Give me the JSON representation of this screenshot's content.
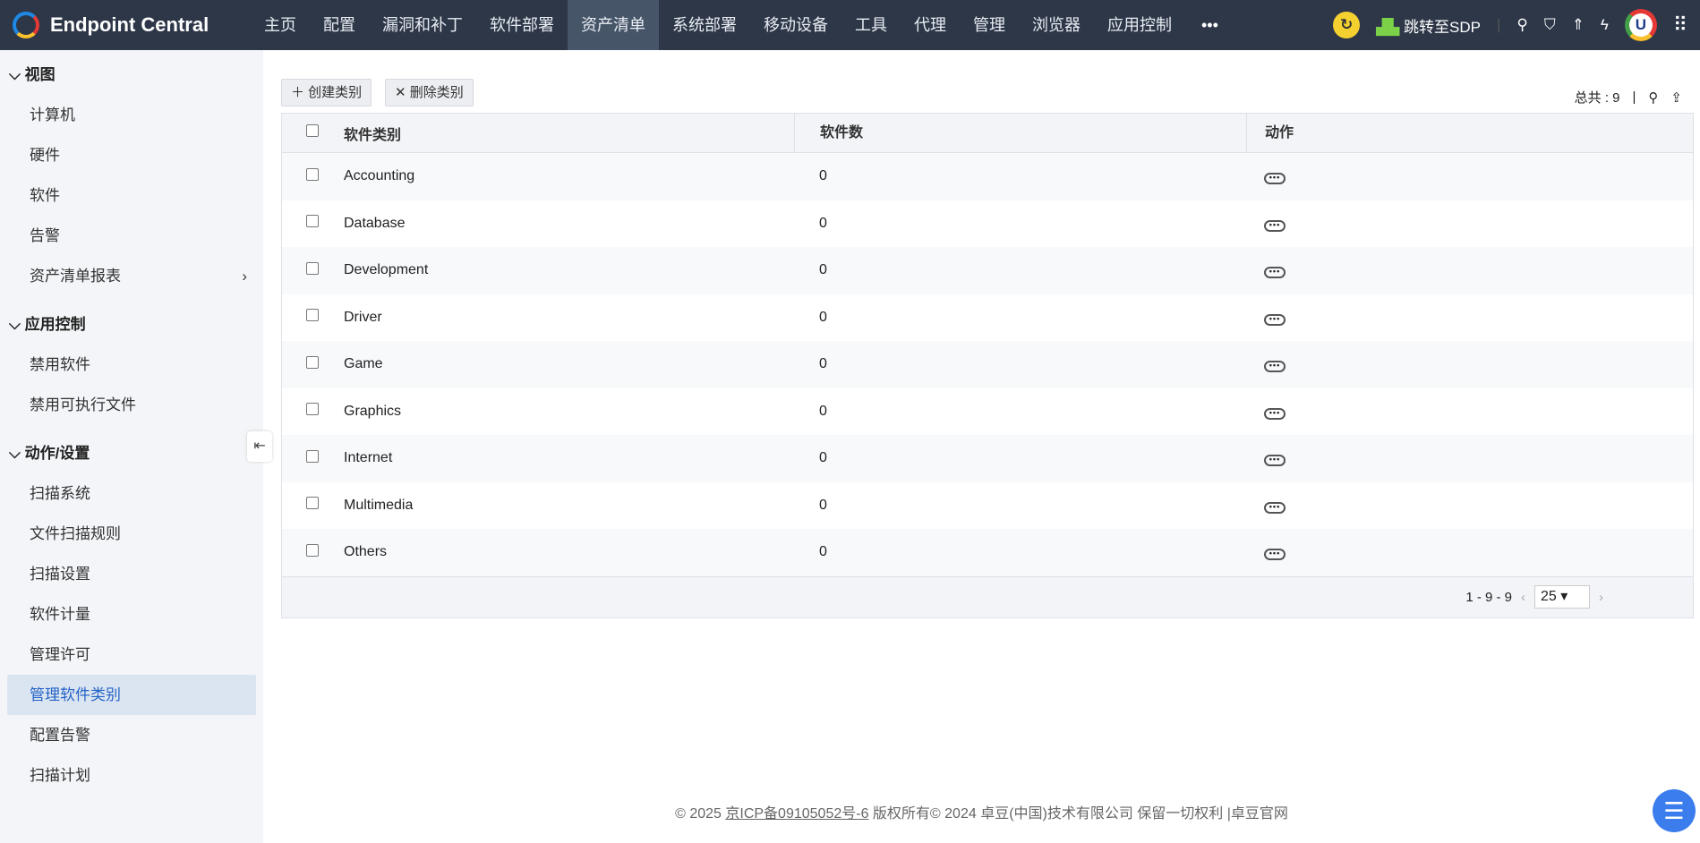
{
  "app": {
    "title": "Endpoint Central"
  },
  "nav": [
    "主页",
    "配置",
    "漏洞和补丁",
    "软件部署",
    "资产清单",
    "系统部署",
    "移动设备",
    "工具",
    "代理",
    "管理",
    "浏览器",
    "应用控制"
  ],
  "nav_more": "•••",
  "topright": {
    "sdp": "跳转至SDP",
    "avatar": "U"
  },
  "sidebar": {
    "sections": [
      {
        "title": "视图",
        "items": [
          "计算机",
          "硬件",
          "软件",
          "告警",
          "资产清单报表"
        ]
      },
      {
        "title": "应用控制",
        "items": [
          "禁用软件",
          "禁用可执行文件"
        ]
      },
      {
        "title": "动作/设置",
        "items": [
          "扫描系统",
          "文件扫描规则",
          "扫描设置",
          "软件计量",
          "管理许可",
          "管理软件类别",
          "配置告警",
          "扫描计划"
        ]
      }
    ],
    "active": "管理软件类别"
  },
  "toolbar": {
    "create": "创建类别",
    "delete": "删除类别",
    "total": "总共 : 9"
  },
  "table": {
    "headers": [
      "软件类别",
      "软件数",
      "动作"
    ],
    "rows": [
      [
        "Accounting",
        "0"
      ],
      [
        "Database",
        "0"
      ],
      [
        "Development",
        "0"
      ],
      [
        "Driver",
        "0"
      ],
      [
        "Game",
        "0"
      ],
      [
        "Graphics",
        "0"
      ],
      [
        "Internet",
        "0"
      ],
      [
        "Multimedia",
        "0"
      ],
      [
        "Others",
        "0"
      ]
    ],
    "range": "1 - 9 - 9",
    "per_page": "25"
  },
  "footer": {
    "pre": "© 2025 ",
    "icp": "京ICP备09105052号-6",
    "post": " 版权所有© 2024 卓豆(中国)技术有限公司 保留一切权利 |卓豆官网"
  }
}
